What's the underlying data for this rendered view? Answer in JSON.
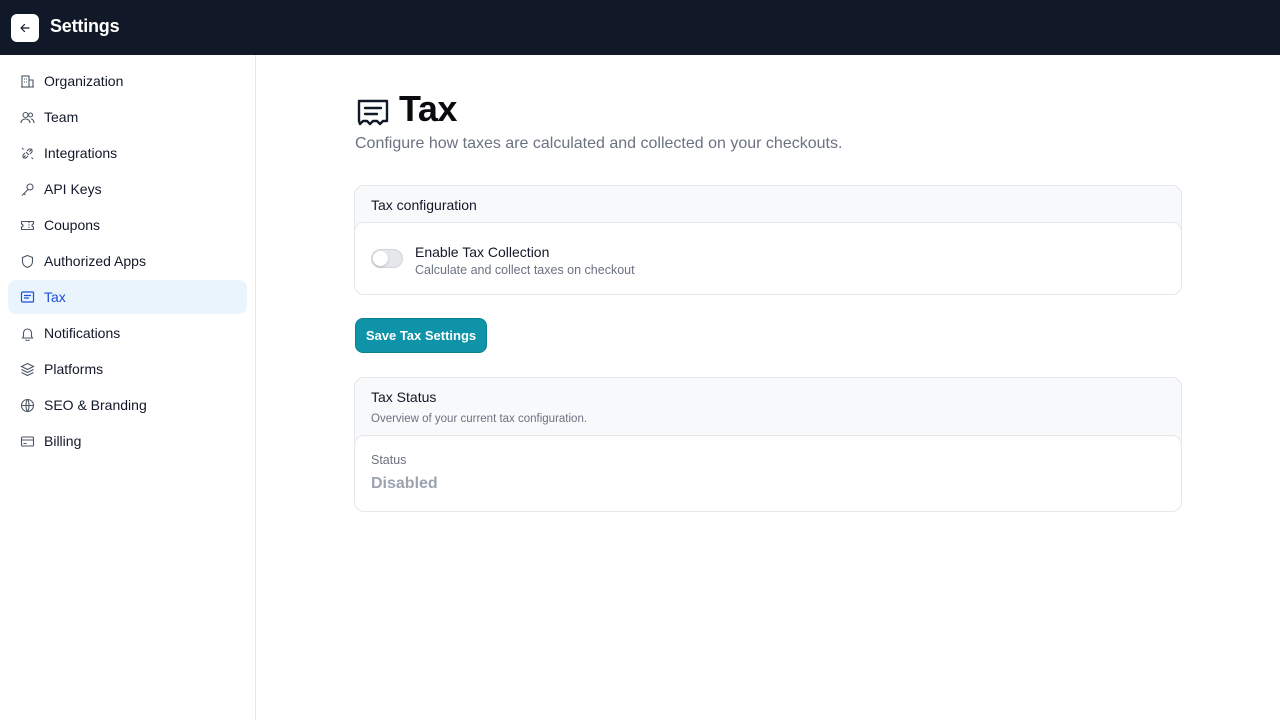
{
  "header": {
    "title": "Settings",
    "back_icon": "arrow-left-icon"
  },
  "sidebar": {
    "items": [
      {
        "label": "Organization",
        "icon": "building-icon",
        "active": false
      },
      {
        "label": "Team",
        "icon": "users-icon",
        "active": false
      },
      {
        "label": "Integrations",
        "icon": "plug-icon",
        "active": false
      },
      {
        "label": "API Keys",
        "icon": "key-icon",
        "active": false
      },
      {
        "label": "Coupons",
        "icon": "ticket-icon",
        "active": false
      },
      {
        "label": "Authorized Apps",
        "icon": "shield-icon",
        "active": false
      },
      {
        "label": "Tax",
        "icon": "receipt-icon",
        "active": true
      },
      {
        "label": "Notifications",
        "icon": "bell-icon",
        "active": false
      },
      {
        "label": "Platforms",
        "icon": "layers-icon",
        "active": false
      },
      {
        "label": "SEO & Branding",
        "icon": "globe-icon",
        "active": false
      },
      {
        "label": "Billing",
        "icon": "credit-card-icon",
        "active": false
      }
    ]
  },
  "page": {
    "title": "Tax",
    "subtitle": "Configure how taxes are calculated and collected on your checkouts.",
    "icon": "receipt-icon"
  },
  "tax_config": {
    "header": "Tax configuration",
    "toggle_title": "Enable Tax Collection",
    "toggle_desc": "Calculate and collect taxes on checkout",
    "enabled": false
  },
  "actions": {
    "save_label": "Save Tax Settings"
  },
  "tax_status": {
    "header": "Tax Status",
    "description": "Overview of your current tax configuration.",
    "status_label": "Status",
    "status_value": "Disabled"
  },
  "colors": {
    "topbar": "#111827",
    "accent": "#0e93a8",
    "active_nav_bg": "#eaf4fd",
    "active_nav_text": "#1d4ed8"
  }
}
